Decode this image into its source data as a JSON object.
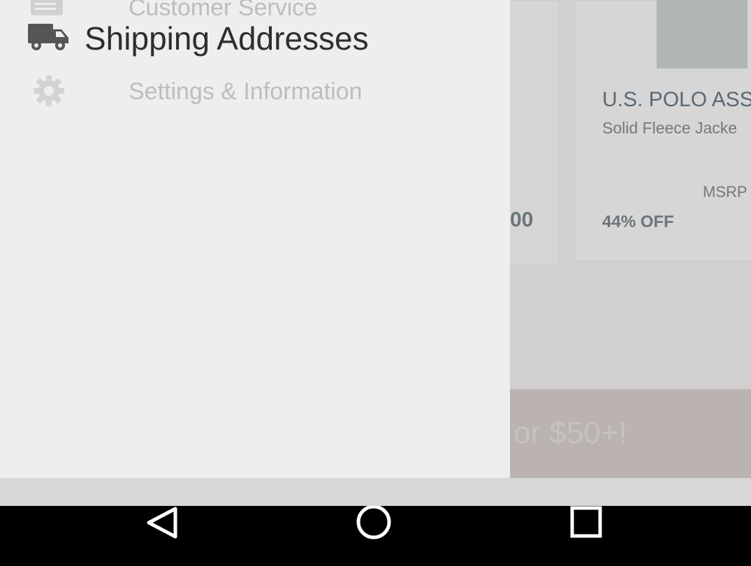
{
  "background": {
    "brand": "U.S. POLO ASS",
    "subtitle": "Solid Fleece Jacke",
    "msrp_label": "MSRP",
    "discount": "44% OFF",
    "price_fragment": "00",
    "banner_text": "or $50+!"
  },
  "drawer": {
    "items": [
      {
        "label": "Customer Service",
        "icon": "chat-icon"
      },
      {
        "label": "Settings & Information",
        "icon": "gear-icon"
      }
    ],
    "dragging_item": {
      "label": "Shipping Addresses",
      "icon": "truck-icon"
    }
  },
  "navbar": {
    "buttons": [
      {
        "name": "back",
        "icon": "back-triangle-icon"
      },
      {
        "name": "home",
        "icon": "home-circle-icon"
      },
      {
        "name": "recents",
        "icon": "recents-square-icon"
      }
    ]
  },
  "colors": {
    "drawer_bg": "#eeeeee",
    "drag_text": "#2e2e2e",
    "faded_text": "#bdbdbd",
    "navbar_bg": "#000000"
  }
}
